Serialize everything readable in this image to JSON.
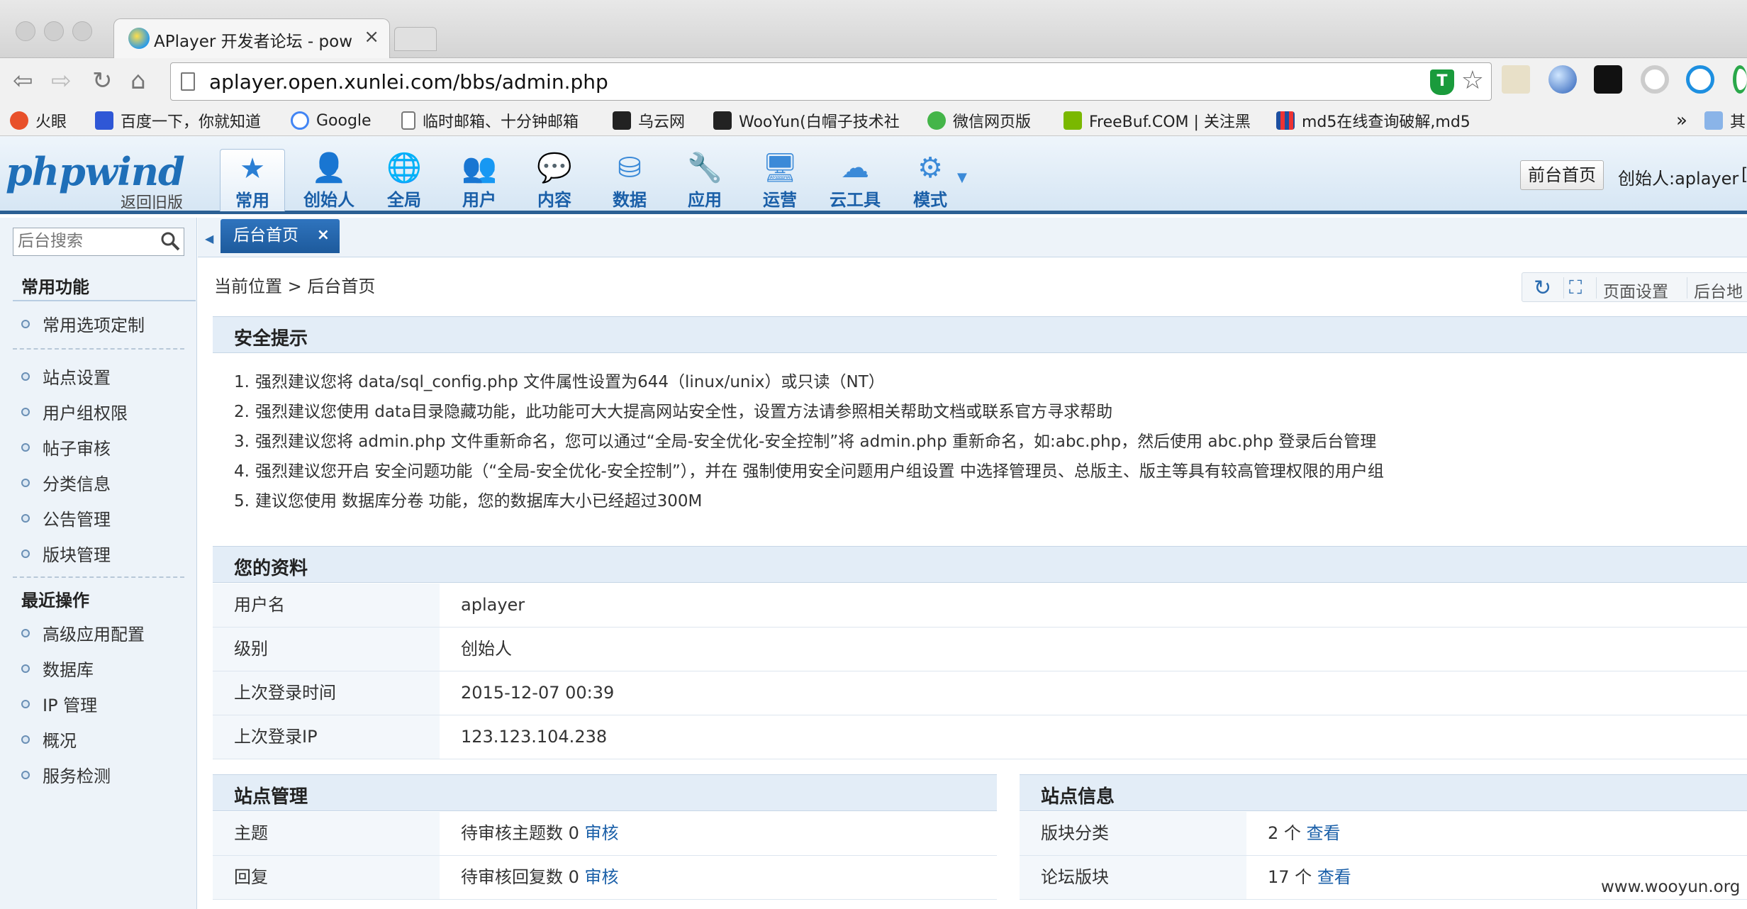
{
  "browser": {
    "tab_title": "APlayer 开发者论坛 - powere",
    "url": "aplayer.open.xunlei.com/bbs/admin.php",
    "bookmarks": [
      {
        "label": "火眼",
        "color": "#e8502a"
      },
      {
        "label": "百度一下，你就知道",
        "color": "#2f57d6"
      },
      {
        "label": "Google",
        "color": "#4285f4"
      },
      {
        "label": "临时邮箱、十分钟邮箱",
        "color": "#888888"
      },
      {
        "label": "乌云网",
        "color": "#222222"
      },
      {
        "label": "WooYun(白帽子技术社",
        "color": "#222222"
      },
      {
        "label": "微信网页版",
        "color": "#44b549"
      },
      {
        "label": "FreeBuf.COM | 关注黑",
        "color": "#7ab800"
      },
      {
        "label": "md5在线查询破解,md5",
        "color": "#1d4fa0"
      }
    ],
    "bookmarks_more": "»",
    "bookmarks_folder": "其"
  },
  "header": {
    "logo": "phpwind",
    "back_link": "返回旧版",
    "nav": [
      {
        "label": "常用",
        "icon": "star-icon",
        "glyph": "★",
        "active": true
      },
      {
        "label": "创始人",
        "icon": "user-icon",
        "glyph": "👤"
      },
      {
        "label": "全局",
        "icon": "globe-icon",
        "glyph": "🌐"
      },
      {
        "label": "用户",
        "icon": "users-icon",
        "glyph": "👥"
      },
      {
        "label": "内容",
        "icon": "chat-icon",
        "glyph": "💬"
      },
      {
        "label": "数据",
        "icon": "database-icon",
        "glyph": "⛁"
      },
      {
        "label": "应用",
        "icon": "wrench-icon",
        "glyph": "🔧"
      },
      {
        "label": "运营",
        "icon": "monitor-icon",
        "glyph": "🖥"
      },
      {
        "label": "云工具",
        "icon": "cloud-icon",
        "glyph": "☁"
      },
      {
        "label": "模式",
        "icon": "gears-icon",
        "glyph": "⚙"
      }
    ],
    "front_button": "前台首页",
    "creator": "创始人:aplayer",
    "creator_bracket": "["
  },
  "sidebar": {
    "search_placeholder": "后台搜索",
    "section_common": "常用功能",
    "common_items": [
      "常用选项定制"
    ],
    "items": [
      "站点设置",
      "用户组权限",
      "帖子审核",
      "分类信息",
      "公告管理",
      "版块管理"
    ],
    "section_recent": "最近操作",
    "recent_items": [
      "高级应用配置",
      "数据库",
      "IP 管理",
      "概况",
      "服务检测"
    ]
  },
  "main": {
    "tab_label": "后台首页",
    "breadcrumb": "当前位置 > 后台首页",
    "tools": {
      "page_settings": "页面设置",
      "map": "后台地"
    },
    "security": {
      "title": "安全提示",
      "tips": [
        "强烈建议您将 data/sql_config.php 文件属性设置为644（linux/unix）或只读（NT）",
        "强烈建议您使用 data目录隐藏功能，此功能可大大提高网站安全性，设置方法请参照相关帮助文档或联系官方寻求帮助",
        "强烈建议您将 admin.php 文件重新命名，您可以通过“全局-安全优化-安全控制”将 admin.php 重新命名，如:abc.php，然后使用 abc.php 登录后台管理",
        "强烈建议您开启 安全问题功能（“全局-安全优化-安全控制”），并在 强制使用安全问题用户组设置 中选择管理员、总版主、版主等具有较高管理权限的用户组",
        "建议您使用 数据库分卷 功能，您的数据库大小已经超过300M"
      ]
    },
    "profile": {
      "title": "您的资料",
      "rows": [
        {
          "key": "用户名",
          "value": "aplayer"
        },
        {
          "key": "级别",
          "value": "创始人"
        },
        {
          "key": "上次登录时间",
          "value": "2015-12-07 00:39"
        },
        {
          "key": "上次登录IP",
          "value": "123.123.104.238"
        }
      ]
    },
    "site_manage": {
      "title": "站点管理",
      "rows": [
        {
          "key": "主题",
          "value": "待审核主题数 0",
          "link": "审核"
        },
        {
          "key": "回复",
          "value": "待审核回复数 0",
          "link": "审核"
        }
      ]
    },
    "site_info": {
      "title": "站点信息",
      "rows": [
        {
          "key": "版块分类",
          "value": "2 个",
          "link": "查看"
        },
        {
          "key": "论坛版块",
          "value": "17 个",
          "link": "查看"
        }
      ]
    }
  },
  "watermark": "www.wooyun.org"
}
